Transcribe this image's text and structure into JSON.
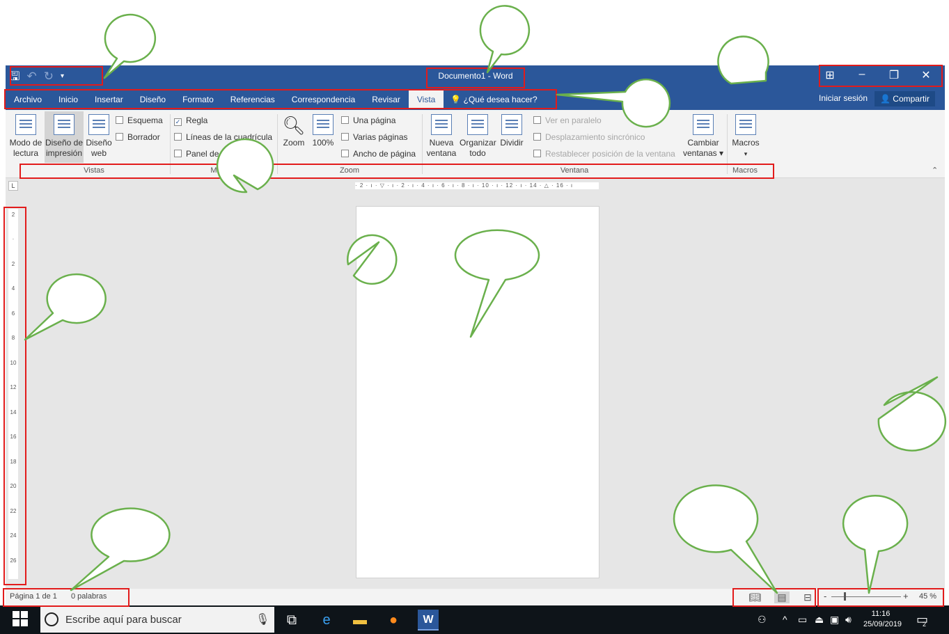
{
  "window": {
    "doc_title": "Documento1 - Word",
    "qat": {
      "save_icon": "save-icon",
      "undo_icon": "undo-icon",
      "redo_icon": "redo-icon",
      "customize_icon": "customize-qat-icon"
    },
    "controls": {
      "ribbon_display_icon": "ribbon-display-options-icon",
      "minimize_icon": "minimize-icon",
      "restore_icon": "restore-icon",
      "close_icon": "close-icon"
    }
  },
  "menu": {
    "tabs": [
      "Archivo",
      "Inicio",
      "Insertar",
      "Diseño",
      "Formato",
      "Referencias",
      "Correspondencia",
      "Revisar",
      "Vista"
    ],
    "active_tab": "Vista",
    "tell_me": "¿Qué desea hacer?",
    "sign_in": "Iniciar sesión",
    "share": "Compartir"
  },
  "ribbon": {
    "vistas": {
      "group": "Vistas",
      "modo_lectura": [
        "Modo de",
        "lectura"
      ],
      "diseno_impresion": [
        "Diseño de",
        "impresión"
      ],
      "diseno_web": [
        "Diseño",
        "web"
      ],
      "esquema": "Esquema",
      "borrador": "Borrador"
    },
    "mostrar": {
      "group": "Mostrar",
      "regla": "Regla",
      "lineas": "Líneas de la cuadrícula",
      "panel": "Panel de navegación"
    },
    "zoom": {
      "group": "Zoom",
      "zoom": "Zoom",
      "cien": "100%",
      "una_pagina": "Una página",
      "varias_paginas": "Varias páginas",
      "ancho_pagina": "Ancho de página"
    },
    "ventana": {
      "group": "Ventana",
      "nueva": [
        "Nueva",
        "ventana"
      ],
      "organizar": [
        "Organizar",
        "todo"
      ],
      "dividir": "Dividir",
      "paralelo": "Ver en paralelo",
      "desplazamiento": "Desplazamiento sincrónico",
      "restablecer": "Restablecer posición de la ventana",
      "cambiar": [
        "Cambiar",
        "ventanas ▾"
      ]
    },
    "macros": {
      "group": "Macros",
      "macros": "Macros"
    }
  },
  "ruler": {
    "horizontal": "· 2 · ı · ▽ · ı · 2 · ı · 4 · ı · 6 · ı · 8 · ı · 10 · ı · 12 · ı · 14 · △ · 16 · ı",
    "vertical_marks": [
      "2",
      "·",
      "2",
      "4",
      "6",
      "8",
      "10",
      "12",
      "14",
      "16",
      "18",
      "20",
      "22",
      "24",
      "26"
    ],
    "corner": "L"
  },
  "status": {
    "page": "Página 1 de 1",
    "words": "0 palabras",
    "zoom_minus": "-",
    "zoom_plus": "+",
    "zoom_level": "45 %"
  },
  "taskbar": {
    "search": "Escribe aquí para buscar",
    "time": "11:16",
    "date": "25/09/2019",
    "notifications": "2"
  },
  "colors": {
    "word_blue": "#2b579a",
    "annotation_red": "#e21b1b",
    "bubble_green": "#6ab04c"
  }
}
